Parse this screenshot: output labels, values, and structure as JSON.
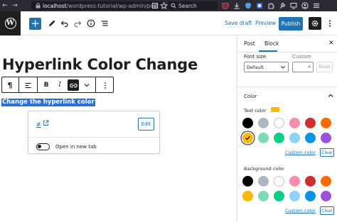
{
  "browser": {
    "back_arrow": "←",
    "forward_arrow": "→",
    "url_host": "localhost",
    "url_path": "/wordpress-tutorial/wp-admin/post",
    "search_label": "Search"
  },
  "toolbar": {
    "add_symbol": "+",
    "save_draft_label": "Save draft",
    "preview_label": "Preview",
    "publish_label": "Publish",
    "wp_logo_text": "W"
  },
  "content": {
    "title": "Hyperlink Color Change",
    "selected_text": "Change the hyperlink color",
    "block_toolbar": {
      "paragraph_symbol": "¶",
      "bold_label": "B",
      "italic_label": "I"
    },
    "link_popover": {
      "link_text": "#",
      "edit_label": "Edit",
      "toggle_label": "Open in new tab",
      "toggle_on": false
    }
  },
  "sidebar": {
    "tabs": [
      {
        "label": "Post",
        "active": false
      },
      {
        "label": "Block",
        "active": true
      }
    ],
    "close_symbol": "✕",
    "font_size": {
      "label": "Font size",
      "custom_label": "Custom",
      "select_value": "Default",
      "input_suffix": "A",
      "reset_label": "Reset"
    },
    "color": {
      "title": "Color",
      "text_color_label": "Text color",
      "text_color_value": "#fcb900",
      "background_color_label": "Background color",
      "custom_color_label": "Custom color",
      "clear_label": "Clear",
      "palette_row1": [
        "#000000",
        "#abb8c3",
        "#ffffff",
        "#f78da7",
        "#cf2e2e",
        "#ff6900"
      ],
      "palette_row2": [
        "#fcb900",
        "#7bdcb5",
        "#00d084",
        "#8ed1fc",
        "#0693e3",
        "#9b51e0"
      ],
      "text_selected_index": 6
    }
  },
  "colors": {
    "accent": "#2271b1",
    "dark": "#1e1e1e",
    "selection": "#2d6fd2",
    "browser_bg": "#2b2a33"
  }
}
